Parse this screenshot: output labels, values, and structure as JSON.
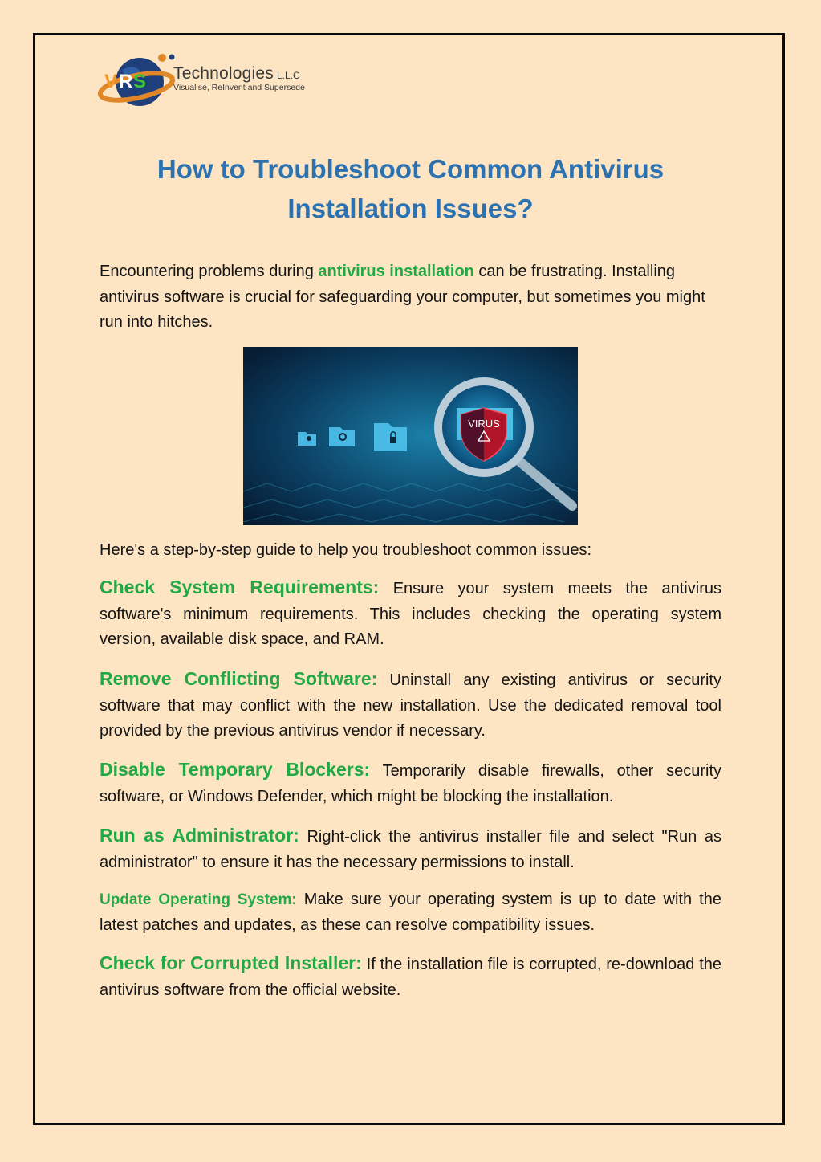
{
  "logo": {
    "mark": "VRS",
    "name": "Technologies",
    "suffix": "L.L.C",
    "tagline": "Visualise, ReInvent and Supersede"
  },
  "title_line1": "How to Troubleshoot Common Antivirus",
  "title_line2": "Installation Issues?",
  "intro": {
    "before": "Encountering problems during ",
    "link": "antivirus installation",
    "after": " can be frustrating. Installing antivirus software is crucial for safeguarding your computer, but sometimes you might run into hitches."
  },
  "hero_image": {
    "alt": "Magnifying glass over folders revealing a virus shield",
    "shield_text": "VIRUS"
  },
  "guide_intro": "Here's a step-by-step guide to help you troubleshoot common issues:",
  "steps": [
    {
      "heading": "Check System Requirements:",
      "text": " Ensure your system meets the antivirus software's minimum requirements. This includes checking the operating system version, available disk space, and RAM."
    },
    {
      "heading": "Remove Conflicting Software:",
      "text": " Uninstall any existing antivirus or security software that may conflict with the new installation. Use the dedicated removal tool provided by the previous antivirus vendor if necessary."
    },
    {
      "heading": "Disable Temporary Blockers:",
      "text": " Temporarily disable firewalls, other security software, or Windows Defender, which might be blocking the installation."
    },
    {
      "heading": "Run as Administrator:",
      "text": " Right-click the antivirus installer file and select \"Run as administrator\" to ensure it has the necessary permissions to install."
    },
    {
      "heading": "Update Operating System:",
      "text": " Make sure your operating system is up to date with the latest patches and updates, as these can resolve compatibility issues."
    },
    {
      "heading": "Check for Corrupted Installer:",
      "text": " If the installation file is corrupted, re-download the antivirus software from the official website."
    }
  ],
  "colors": {
    "background": "#fde5c4",
    "title": "#2d72b0",
    "accent_green": "#22a845",
    "border": "#0b0b0b"
  }
}
